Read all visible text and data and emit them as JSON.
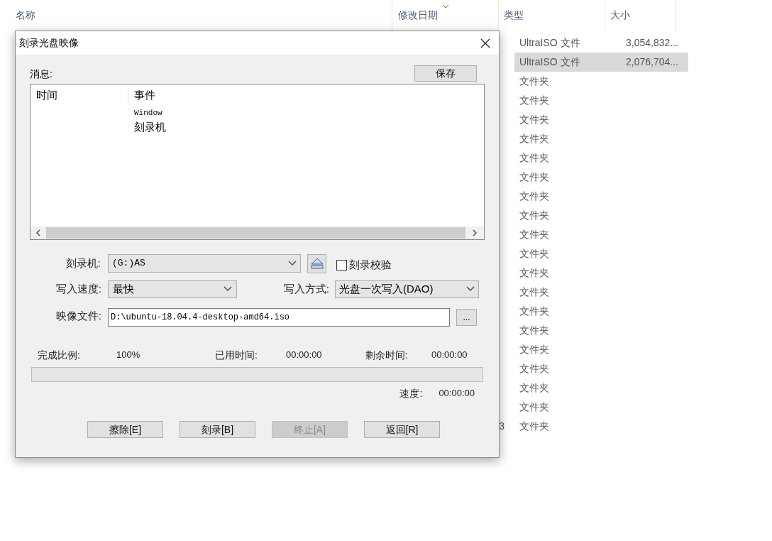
{
  "explorer": {
    "columns": [
      {
        "label": "名称",
        "sorted": false
      },
      {
        "label": "修改日期",
        "sorted": true
      },
      {
        "label": "类型",
        "sorted": false
      },
      {
        "label": "大小",
        "sorted": false
      }
    ],
    "rows": [
      {
        "type": "UltraISO 文件",
        "size": "3,054,832...",
        "selected": false
      },
      {
        "type": "UltraISO 文件",
        "size": "2,076,704...",
        "selected": true
      },
      {
        "type": "文件夹",
        "selected": false
      },
      {
        "type": "文件夹",
        "selected": false
      },
      {
        "type": "文件夹",
        "selected": false
      },
      {
        "type": "文件夹",
        "selected": false
      },
      {
        "type": "文件夹",
        "selected": false
      },
      {
        "type": "文件夹",
        "selected": false
      },
      {
        "type": "文件夹",
        "selected": false
      },
      {
        "type": "文件夹",
        "selected": false
      },
      {
        "type": "文件夹",
        "selected": false
      },
      {
        "type": "文件夹",
        "selected": false
      },
      {
        "type": "文件夹",
        "selected": false
      },
      {
        "type": "文件夹",
        "selected": false
      },
      {
        "type": "文件夹",
        "selected": false
      },
      {
        "type": "文件夹",
        "selected": false
      },
      {
        "type": "文件夹",
        "selected": false
      },
      {
        "type": "文件夹",
        "selected": false
      },
      {
        "type": "文件夹",
        "selected": false
      },
      {
        "type": "文件夹",
        "selected": false
      },
      {
        "date": "3",
        "type": "文件夹",
        "selected": false
      }
    ]
  },
  "dialog": {
    "title": "刻录光盘映像",
    "messages": {
      "label": "消息:",
      "save_button": "保存",
      "columns": [
        "时间",
        "事件"
      ],
      "rows": [
        {
          "event": "Window",
          "kind": "mono"
        },
        {
          "event": "刻录机",
          "kind": "normal"
        }
      ]
    },
    "burner": {
      "label": "刻录机:",
      "value": "(G:)AS"
    },
    "verify": {
      "label": "刻录校验",
      "checked": false
    },
    "speed": {
      "label": "写入速度:",
      "value": "最快"
    },
    "method": {
      "label": "写入方式:",
      "value": "光盘一次写入(DAO)"
    },
    "image_file": {
      "label": "映像文件:",
      "value": "D:\\ubuntu-18.04.4-desktop-amd64.iso",
      "browse": "..."
    },
    "progress": {
      "percent_label": "完成比例:",
      "percent": "100%",
      "elapsed_label": "已用时间:",
      "elapsed": "00:00:00",
      "remaining_label": "剩余时间:",
      "remaining": "00:00:00",
      "level": 0,
      "speed_label": "速度:",
      "speed": "00:00:00"
    },
    "buttons": [
      {
        "label": "擦除[E]",
        "disabled": false
      },
      {
        "label": "刻录[B]",
        "disabled": false
      },
      {
        "label": "终止[A]",
        "disabled": true
      },
      {
        "label": "返回[R]",
        "disabled": false
      }
    ]
  }
}
